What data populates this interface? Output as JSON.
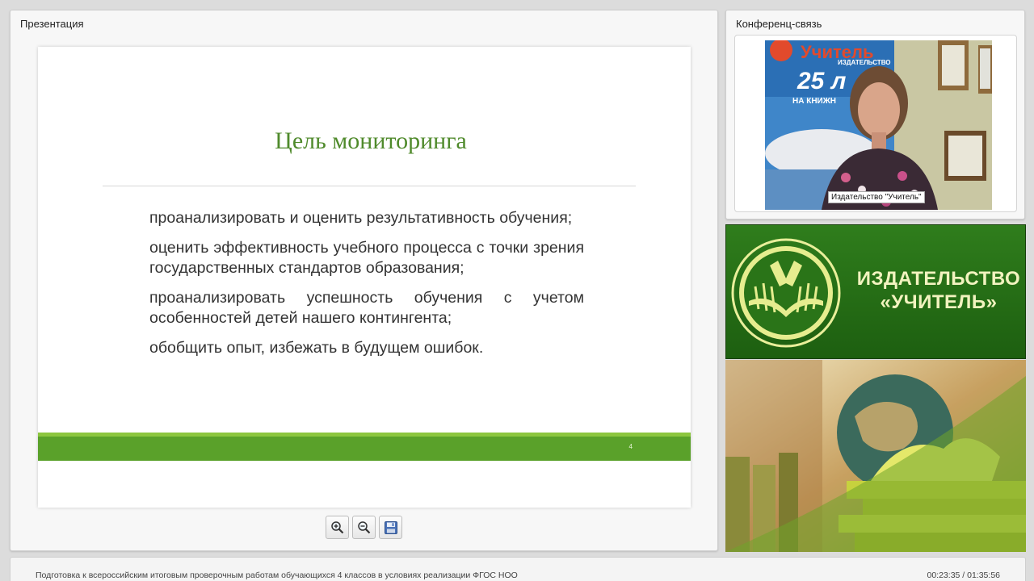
{
  "presentation_panel": {
    "title": "Презентация",
    "slide": {
      "title": "Цель мониторинга",
      "bullets": [
        "проанализировать и оценить результативность обучения;",
        "оценить эффективность учебного процесса с точки зрения государственных стандартов образования;",
        "проанализировать успешность обучения с учетом особенностей детей нашего контингента;",
        "обобщить опыт, избежать в будущем ошибок."
      ],
      "page_number": "4"
    },
    "toolbar": {
      "zoom_in_icon": "zoom-in-icon",
      "zoom_out_icon": "zoom-out-icon",
      "save_icon": "save-icon"
    }
  },
  "conference_panel": {
    "title": "Конференц-связь",
    "video_caption": "Издательство \"Учитель\"",
    "backdrop_poster": {
      "line1": "Учитель",
      "line2": "ИЗДАТЕЛЬСТВО",
      "line3": "25 л",
      "line4": "НА КНИЖН"
    }
  },
  "logo_banner": {
    "line1": "ИЗДАТЕЛЬСТВО",
    "line2": "«УЧИТЕЛЬ»"
  },
  "footer": {
    "webinar_title": "Подготовка к всероссийским итоговым проверочным работам обучающихся 4 классов в условиях реализации ФГОС НОО",
    "time": "00:23:35 / 01:35:56"
  },
  "colors": {
    "slide_title": "#4f8a2b",
    "slide_band": "#5aa12a",
    "logo_green": "#2f7d1c",
    "logo_text": "#f2f3bf"
  }
}
